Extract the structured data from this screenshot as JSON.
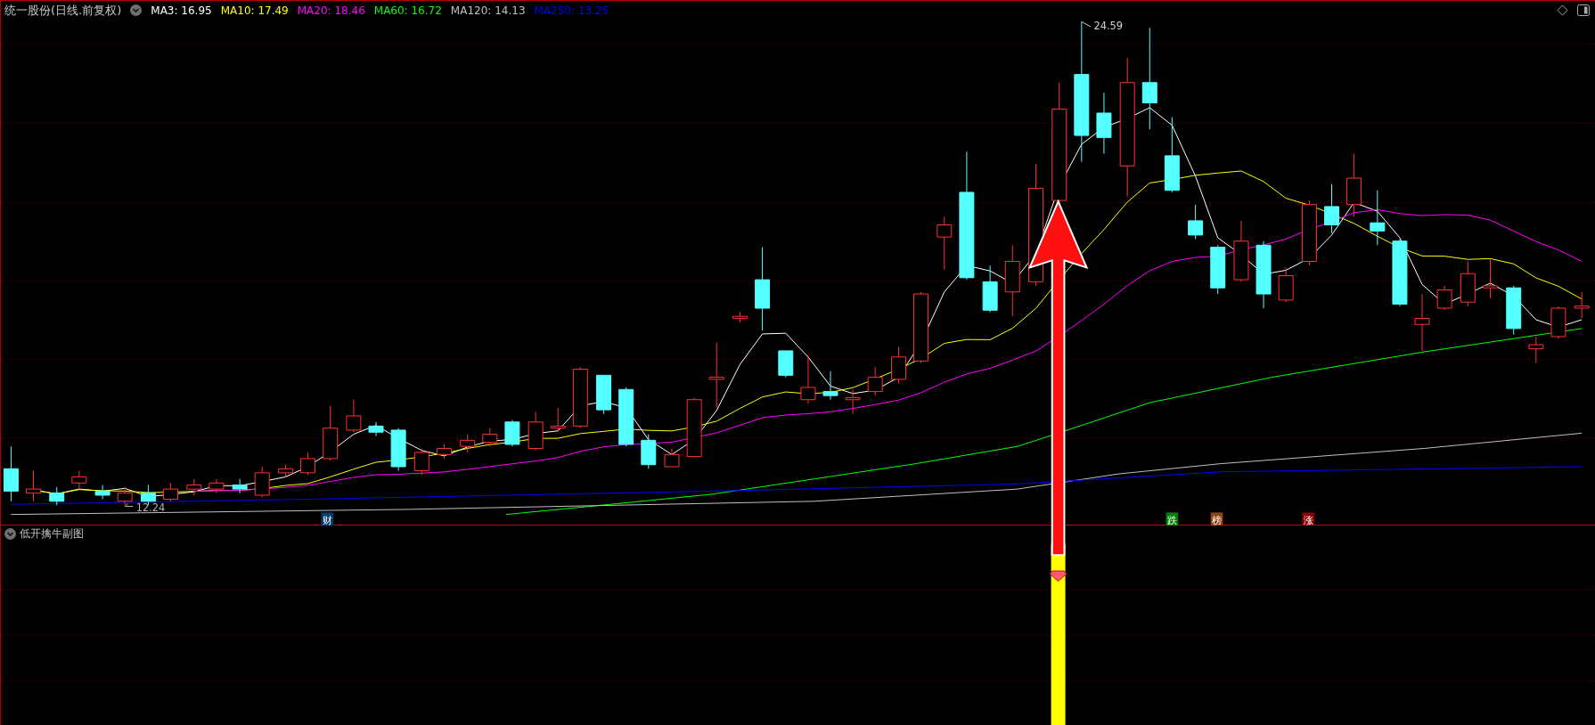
{
  "header": {
    "title": "统一股份(日线.前复权)",
    "indicators": [
      {
        "text": "MA3: 16.95",
        "color": "#ffffff"
      },
      {
        "text": "MA10: 17.49",
        "color": "#ffff00"
      },
      {
        "text": "MA20: 18.46",
        "color": "#ff00ff"
      },
      {
        "text": "MA60: 16.72",
        "color": "#00ff00"
      },
      {
        "text": "MA120: 14.13",
        "color": "#c0c0c0"
      },
      {
        "text": "MA250: 13.25",
        "color": "#0000ff"
      }
    ]
  },
  "chart_marks": {
    "high_label": "24.59",
    "low_label": "12.24"
  },
  "event_tags": [
    {
      "text": "财",
      "color": "#0a3c6e"
    },
    {
      "text": "跌",
      "color": "#008000"
    },
    {
      "text": "榜",
      "color": "#8b4513"
    },
    {
      "text": "涨",
      "color": "#8b0000"
    }
  ],
  "sub_panel": {
    "title": "低开擒牛副图"
  }
}
